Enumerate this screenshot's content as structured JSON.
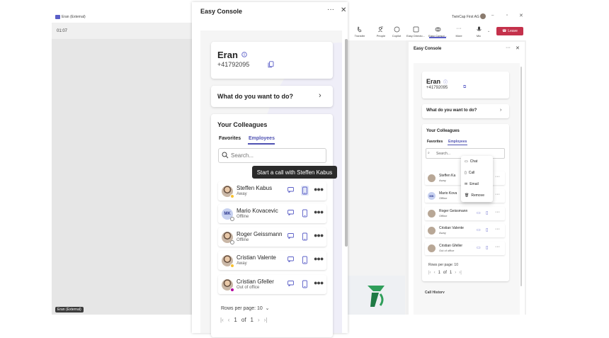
{
  "background_call": {
    "window_title": "Eran (External)",
    "timer": "01:07",
    "participant_tag": "Eran (External)"
  },
  "teams_toolbar": {
    "org_name": "TwinCap First AG",
    "items": [
      {
        "label": "Transfer",
        "icon": "transfer-icon"
      },
      {
        "label": "People",
        "icon": "people-icon",
        "count": "2"
      },
      {
        "label": "Copilot",
        "icon": "copilot-icon"
      },
      {
        "label": "Easy Directo...",
        "icon": "directory-icon"
      },
      {
        "label": "Easy Consol...",
        "icon": "console-icon"
      },
      {
        "label": "More",
        "icon": "more-icon"
      },
      {
        "label": "Mic",
        "icon": "mic-icon"
      }
    ],
    "leave_label": "Leave"
  },
  "main_panel": {
    "title": "Easy Console",
    "contact": {
      "name": "Eran",
      "phone": "+41792095"
    },
    "action_prompt": "What do you want to do?",
    "colleagues": {
      "title": "Your Colleagues",
      "tabs": [
        {
          "label": "Favorites",
          "active": false
        },
        {
          "label": "Employees",
          "active": true
        }
      ],
      "search_placeholder": "Search...",
      "tooltip": "Start a call with Steffen Kabus",
      "list": [
        {
          "name": "Steffen Kabus",
          "status": "Away",
          "avatar": "photo",
          "presence": "away"
        },
        {
          "name": "Mario Kovacevic",
          "status": "Offline",
          "avatar": "MK",
          "presence": "offline"
        },
        {
          "name": "Roger Geissmann",
          "status": "Offline",
          "avatar": "photo",
          "presence": "offline"
        },
        {
          "name": "Cristian Valente",
          "status": "Away",
          "avatar": "photo",
          "presence": "away"
        },
        {
          "name": "Cristian Gfeller",
          "status": "Out of office",
          "avatar": "photo",
          "presence": "ooo"
        }
      ],
      "rows_per_page_label": "Rows per page: 10",
      "pagination": {
        "current": "1",
        "of_label": "of",
        "total": "1"
      }
    }
  },
  "side_panel": {
    "title": "Easy Console",
    "contact": {
      "name": "Eran",
      "phone": "+41792095"
    },
    "action_prompt": "What do you want to do?",
    "colleagues_title": "Your Colleagues",
    "tabs": [
      "Favorites",
      "Employees"
    ],
    "search_placeholder": "Search...",
    "list": [
      {
        "name": "Steffen Ka",
        "status": "Away"
      },
      {
        "name": "Mario Kova",
        "status": "Offline"
      },
      {
        "name": "Roger Geissmann",
        "status": "Offline"
      },
      {
        "name": "Cristian Valente",
        "status": "Away"
      },
      {
        "name": "Cristian Gfeller",
        "status": "Out of office"
      }
    ],
    "context_menu": [
      "Chat",
      "Call",
      "Email",
      "Remove"
    ],
    "rows_per_page_label": "Rows per page: 10",
    "pagination": {
      "current": "1",
      "of_label": "of",
      "total": "1"
    },
    "cut_off_label": "Call History"
  },
  "colors": {
    "accent": "#4f52b2",
    "leave": "#c4314b",
    "away": "#f8c131",
    "out_of_office": "#b4009e"
  }
}
